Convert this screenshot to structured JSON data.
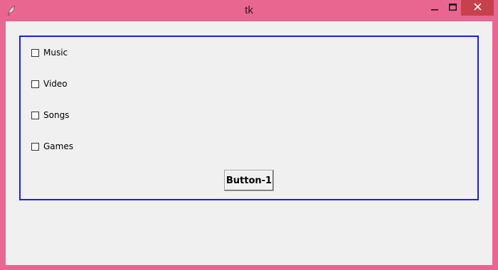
{
  "window": {
    "title": "tk",
    "controls": {
      "minimize_glyph": "—",
      "close_glyph": "✕"
    }
  },
  "icons": {
    "app": "feather-icon",
    "minimize": "minimize-icon",
    "maximize": "maximize-icon",
    "close": "close-icon"
  },
  "colors": {
    "titlebar": "#e8668f",
    "close_hover": "#c7414b",
    "frame_border": "#1a1aff",
    "client_bg": "#f0f0f0"
  },
  "checkboxes": [
    {
      "label": "Music",
      "checked": false
    },
    {
      "label": "Video",
      "checked": false
    },
    {
      "label": "Songs",
      "checked": false
    },
    {
      "label": "Games",
      "checked": false
    }
  ],
  "button": {
    "label": "Button-1"
  }
}
